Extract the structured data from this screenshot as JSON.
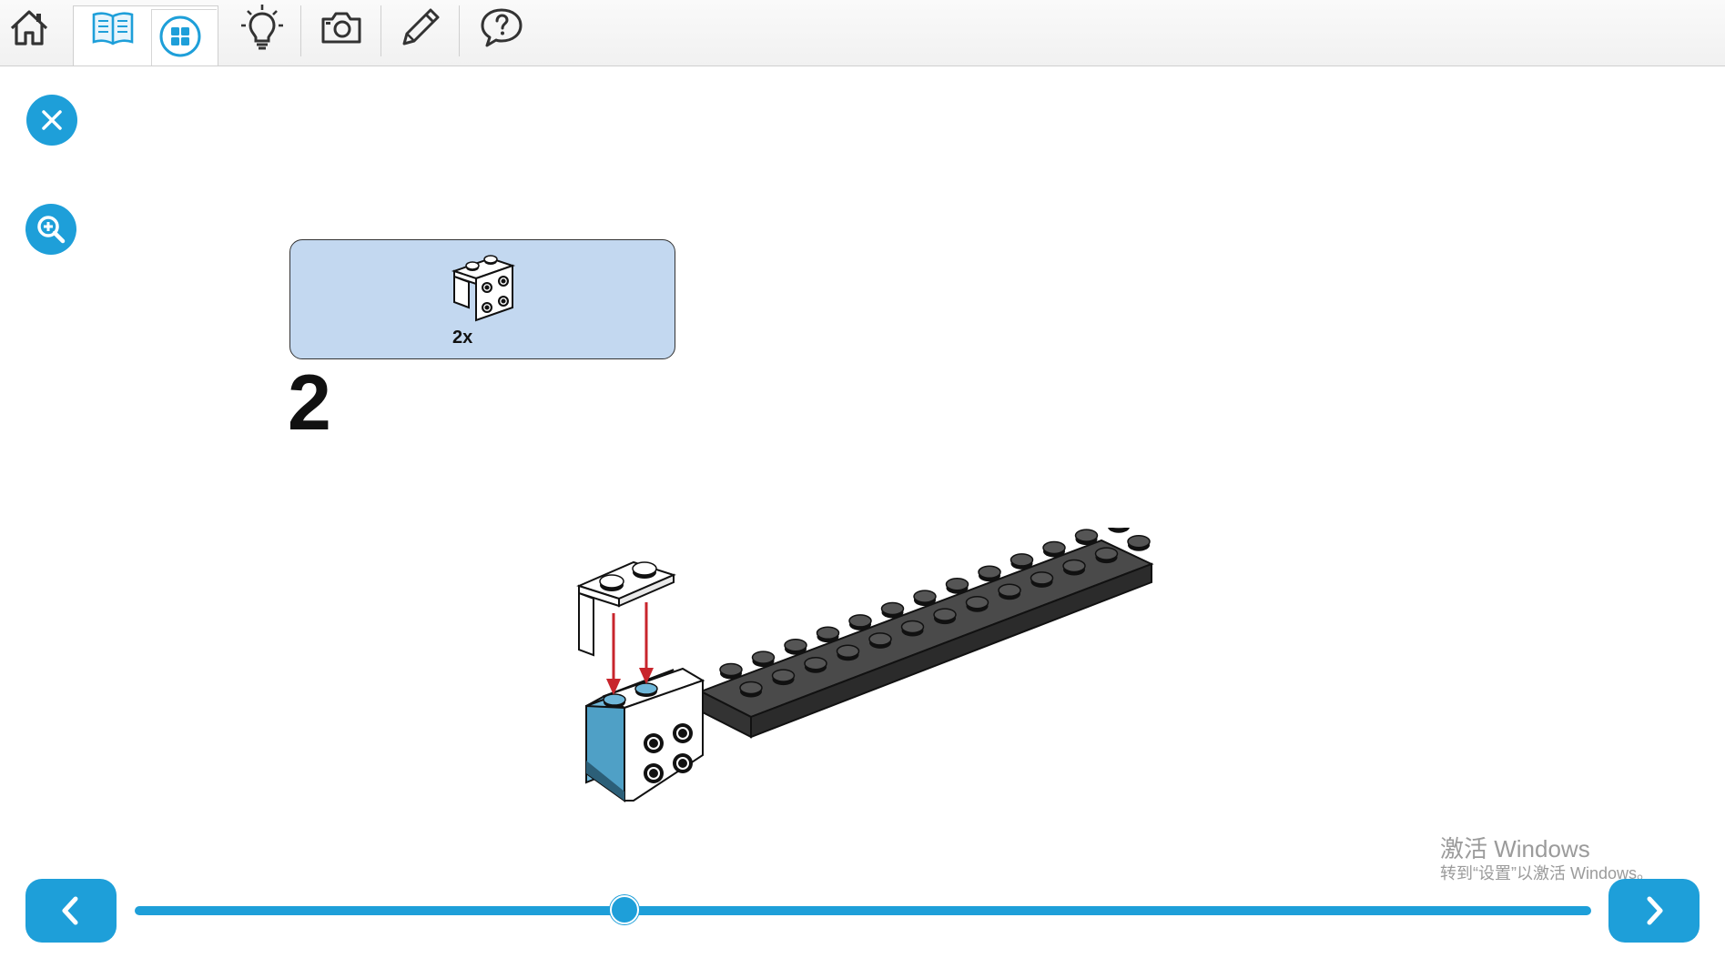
{
  "toolbar": {
    "items": [
      {
        "icon": "home-icon"
      },
      {
        "icon": "book-icon"
      },
      {
        "icon": "grid-icon"
      },
      {
        "icon": "lightbulb-icon"
      },
      {
        "icon": "camera-icon"
      },
      {
        "icon": "pencil-icon"
      },
      {
        "icon": "help-bubble-icon"
      }
    ]
  },
  "side_controls": {
    "close_icon": "close-icon",
    "zoom_icon": "zoom-in-icon"
  },
  "instruction": {
    "part_count": "2x",
    "step_number": "2"
  },
  "watermark": {
    "line1": "激活 Windows",
    "line2": "转到“设置”以激活 Windows。"
  },
  "navigation": {
    "prev_icon": "chevron-left-icon",
    "next_icon": "chevron-right-icon",
    "progress": 0.336
  },
  "colors": {
    "accent": "#1e9fd9",
    "parts_box": "#c3d8f0",
    "plate": "#3a3a3a",
    "highlight_brick": "#6fb7d9",
    "arrow": "#c8252c"
  }
}
